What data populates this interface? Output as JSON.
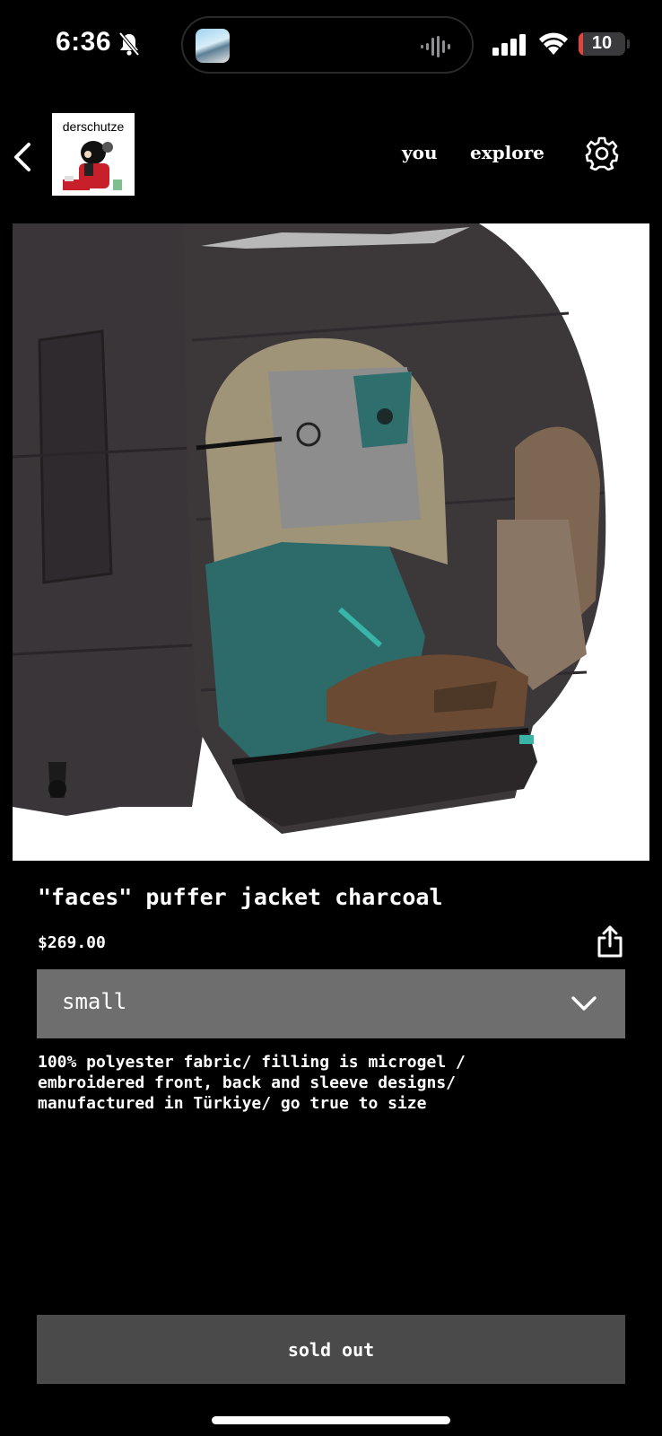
{
  "status_bar": {
    "time": "6:36",
    "battery": "10",
    "battery_level": 0.1,
    "icons": [
      "bell-slash-icon",
      "waveform-icon",
      "cellular-signal-icon",
      "wifi-icon",
      "battery-icon"
    ]
  },
  "header": {
    "store_name": "derschutze",
    "nav": {
      "you": "you",
      "explore": "explore"
    },
    "icons": [
      "chevron-left-icon",
      "gear-icon"
    ]
  },
  "product": {
    "title": "\"faces\" puffer jacket charcoal",
    "price": "$269.00",
    "size_selected": "small",
    "description": "100% polyester fabric/ filling is microgel /\nembroidered front, back and sleeve designs/\nmanufactured in Türkiye/ go true to size",
    "buy_label": "sold out",
    "icons": [
      "share-icon",
      "chevron-down-icon"
    ]
  },
  "colors": {
    "background": "#000000",
    "select_bg": "#6e6e6e",
    "button_bg": "#4a4a4a",
    "battery_low": "#e0443a"
  }
}
